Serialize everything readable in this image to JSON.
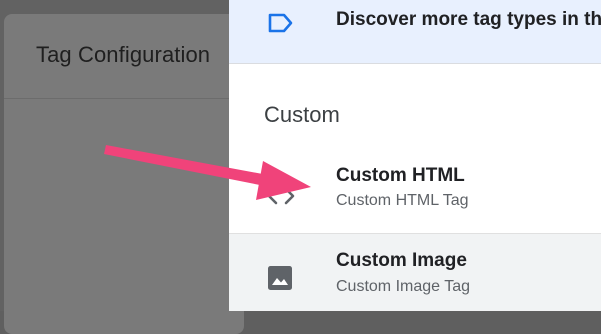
{
  "background": {
    "dialog_title": "Tag Configuration"
  },
  "panel": {
    "discover": {
      "icon": "tag-outline-icon",
      "text": "Discover more tag types in the"
    },
    "section_title": "Custom",
    "items": [
      {
        "icon": "code-icon",
        "name": "Custom HTML",
        "subtitle": "Custom HTML Tag"
      },
      {
        "icon": "image-icon",
        "name": "Custom Image",
        "subtitle": "Custom Image Tag"
      }
    ]
  },
  "annotation": {
    "arrow_color": "#f0437a",
    "points_to": "Custom HTML"
  },
  "colors": {
    "accent_blue": "#1a73e8",
    "discover_bg": "#e8f0fe",
    "hover_bg": "#f1f3f4"
  }
}
